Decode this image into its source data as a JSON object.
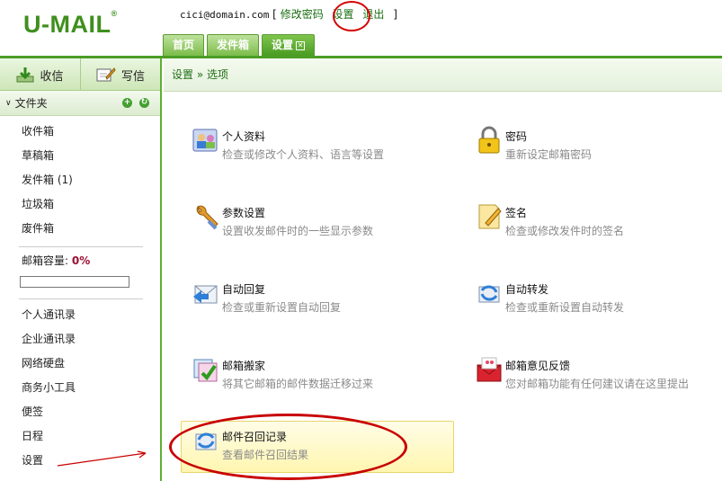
{
  "header": {
    "logo": "U-MAIL",
    "logo_mark": "®",
    "email": "cici@domain.com",
    "bracket_open": "[",
    "change_password": "修改密码",
    "settings": "设置",
    "logout": "退出",
    "bracket_close": "]",
    "tabs": [
      {
        "label": "首页"
      },
      {
        "label": "发件箱"
      },
      {
        "label": "设置"
      }
    ]
  },
  "sidebar": {
    "receive": "收信",
    "compose": "写信",
    "folder_title": "文件夹",
    "folders": [
      "收件箱",
      "草稿箱",
      "发件箱 (1)",
      "垃圾箱",
      "废件箱"
    ],
    "quota_label": "邮箱容量:",
    "quota_value": "0%",
    "quota_fraction": 0,
    "tools": [
      "个人通讯录",
      "企业通讯录",
      "网络硬盘",
      "商务小工具",
      "便签",
      "日程",
      "设置"
    ]
  },
  "main": {
    "breadcrumb": "设置 » 选项",
    "items": [
      {
        "title": "个人资料",
        "desc": "检查或修改个人资料、语言等设置",
        "icon": "profile-icon"
      },
      {
        "title": "密码",
        "desc": "重新设定邮箱密码",
        "icon": "lock-icon"
      },
      {
        "title": "参数设置",
        "desc": "设置收发邮件时的一些显示参数",
        "icon": "wrench-icon"
      },
      {
        "title": "签名",
        "desc": "检查或修改发件时的签名",
        "icon": "signature-icon"
      },
      {
        "title": "自动回复",
        "desc": "检查或重新设置自动回复",
        "icon": "auto-reply-icon"
      },
      {
        "title": "自动转发",
        "desc": "检查或重新设置自动转发",
        "icon": "auto-forward-icon"
      },
      {
        "title": "邮箱搬家",
        "desc": "将其它邮箱的邮件数据迁移过来",
        "icon": "mailbox-move-icon"
      },
      {
        "title": "邮箱意见反馈",
        "desc": "您对邮箱功能有任何建议请在这里提出",
        "icon": "feedback-icon"
      },
      {
        "title": "邮件召回记录",
        "desc": "查看邮件召回结果",
        "icon": "recall-icon"
      }
    ]
  },
  "colors": {
    "brand": "#3f8f1e",
    "accent": "#4b9d25",
    "annotation": "#c80000"
  }
}
